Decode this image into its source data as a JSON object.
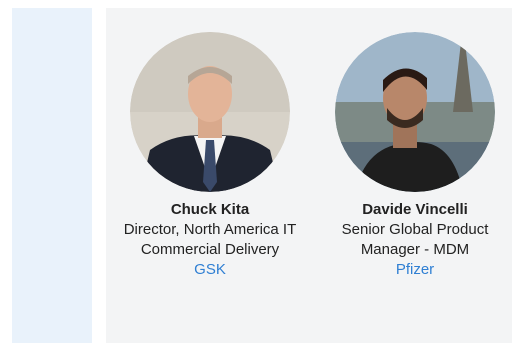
{
  "speakers": [
    {
      "name": "Chuck Kita",
      "role": "Director, North America IT Commercial Delivery",
      "company": "GSK",
      "photo_icon": "person-photo"
    },
    {
      "name": "Davide Vincelli",
      "role": "Senior Global Product Manager - MDM",
      "company": "Pfizer",
      "photo_icon": "person-photo"
    }
  ],
  "colors": {
    "rail": "#e9f2fb",
    "panel": "#f3f4f5",
    "link": "#2f7fd3"
  }
}
